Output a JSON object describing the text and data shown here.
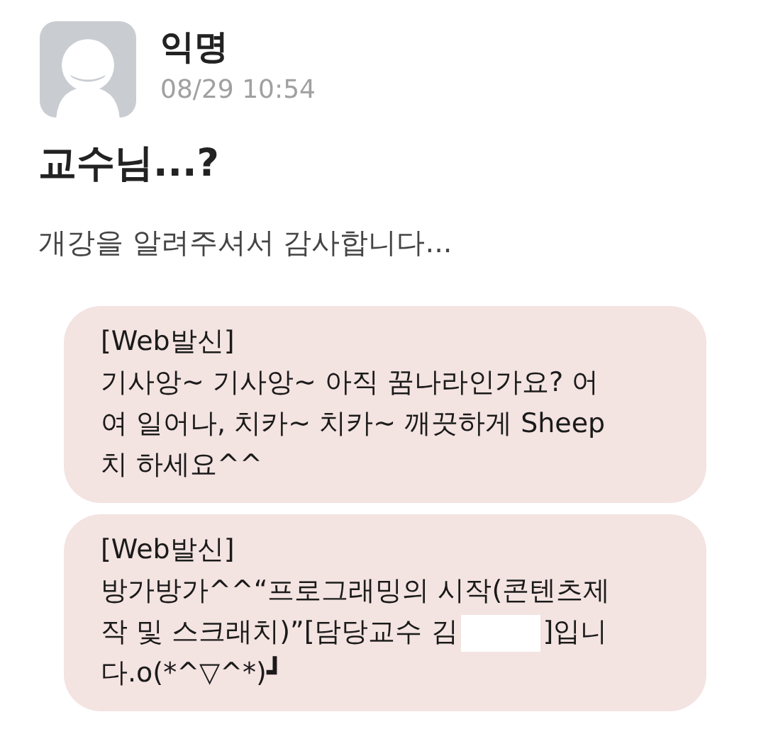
{
  "post": {
    "author": "익명",
    "time": "08/29 10:54",
    "title": "교수님...?",
    "body": "개강을 알려주셔서 감사합니다..."
  },
  "messages": [
    {
      "header": "[Web발신]",
      "lines": [
        [
          {
            "kind": "text",
            "text": "기사앙~ 기사앙~ 아직 꿈나라인가요? 어"
          }
        ],
        [
          {
            "kind": "text",
            "text": "여 일어나, 치카~ 치카~ 깨끗하게 Sheep"
          }
        ],
        [
          {
            "kind": "text",
            "text": "치 하세요^^"
          }
        ]
      ]
    },
    {
      "header": "[Web발신]",
      "lines": [
        [
          {
            "kind": "text",
            "text": "방가방가^^“프로그래밍의 시작(콘텐츠제"
          }
        ],
        [
          {
            "kind": "text",
            "text": "작 및 스크래치)”[담당교수 김"
          },
          {
            "kind": "redaction"
          },
          {
            "kind": "text",
            "text": "]입니"
          }
        ],
        [
          {
            "kind": "text",
            "text": "다.o(*^▽^*)┛"
          }
        ]
      ]
    }
  ]
}
